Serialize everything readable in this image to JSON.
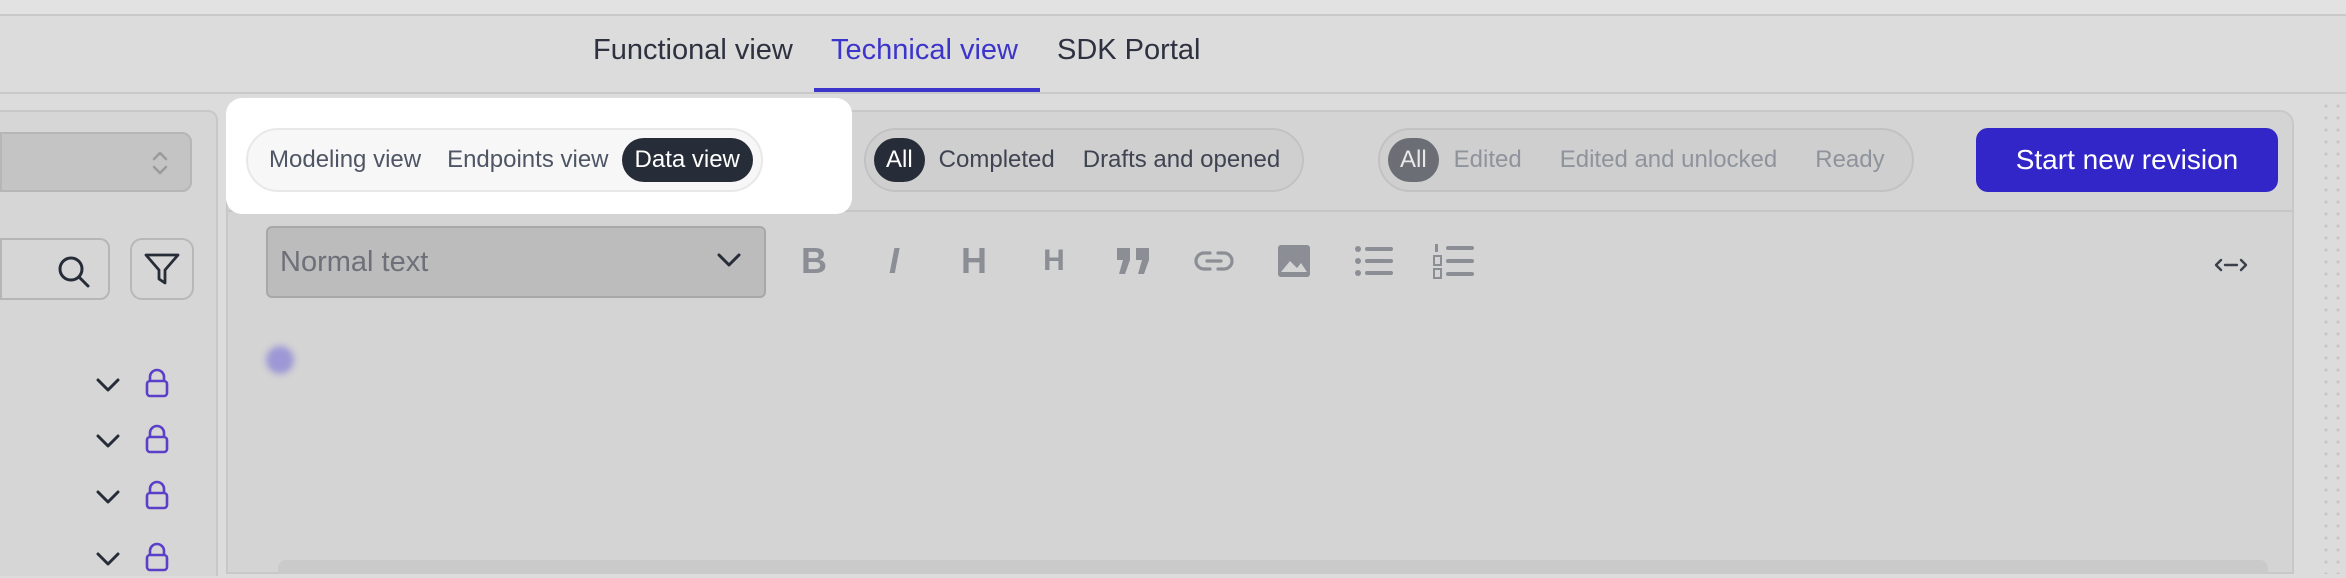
{
  "top_nav": {
    "tabs": [
      {
        "label": "Functional view",
        "active": false
      },
      {
        "label": "Technical view",
        "active": true
      },
      {
        "label": "SDK Portal",
        "active": false
      }
    ]
  },
  "view_switch": {
    "options": [
      "Modeling view",
      "Endpoints view",
      "Data view"
    ],
    "selected": "Data view"
  },
  "status_filter": {
    "options": [
      "All",
      "Completed",
      "Drafts and opened"
    ],
    "selected": "All"
  },
  "edit_filter": {
    "options": [
      "All",
      "Edited",
      "Edited and unlocked",
      "Ready"
    ],
    "selected": "All"
  },
  "actions": {
    "start_revision": "Start new revision"
  },
  "editor_toolbar": {
    "text_style": "Normal text",
    "bold_glyph": "B",
    "italic_glyph": "I",
    "heading1_glyph": "H",
    "heading2_glyph": "H",
    "tools": [
      "bold-icon",
      "italic-icon",
      "heading-1-icon",
      "heading-2-icon",
      "quote-icon",
      "link-icon",
      "image-icon",
      "bullet-list-icon",
      "numbered-list-icon",
      "expand-width-icon"
    ]
  },
  "sidebar": {
    "tree_rows": 4,
    "icons": [
      "chevron-down-icon",
      "lock-icon"
    ]
  },
  "colors": {
    "accent": "#3226c9",
    "active_tab": "#3b35c9",
    "selected_pill": "#262c38",
    "lock": "#5b3fc8"
  }
}
